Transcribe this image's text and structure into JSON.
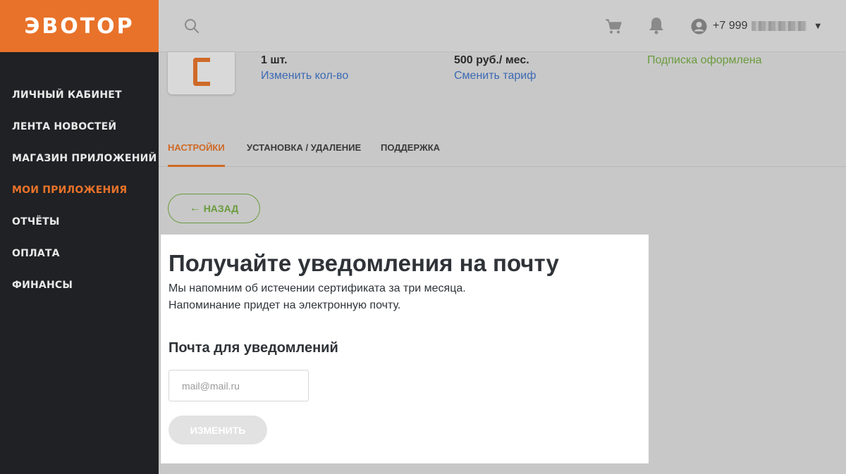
{
  "brand": {
    "logo_text": "ЭВОТОР",
    "accent": "#e8722a"
  },
  "sidebar": {
    "items": [
      {
        "label": "ЛИЧНЫЙ КАБИНЕТ",
        "active": false
      },
      {
        "label": "ЛЕНТА НОВОСТЕЙ",
        "active": false
      },
      {
        "label": "МАГАЗИН ПРИЛОЖЕНИЙ",
        "active": false
      },
      {
        "label": "МОИ ПРИЛОЖЕНИЯ",
        "active": true
      },
      {
        "label": "ОТЧЁТЫ",
        "active": false
      },
      {
        "label": "ОПЛАТА",
        "active": false
      },
      {
        "label": "ФИНАНСЫ",
        "active": false
      }
    ]
  },
  "topbar": {
    "icons": [
      "search-icon",
      "cart-icon",
      "bell-icon",
      "user-icon"
    ],
    "phone": "+7 999"
  },
  "app_summary": {
    "quantity": "1 шт.",
    "change_quantity": "Изменить кол-во",
    "price": "500 руб./ мес.",
    "change_plan": "Сменить тариф",
    "status": "Подписка оформлена"
  },
  "tabs": [
    {
      "label": "НАСТРОЙКИ",
      "active": true
    },
    {
      "label": "УСТАНОВКА / УДАЛЕНИЕ",
      "active": false
    },
    {
      "label": "ПОДДЕРЖКА",
      "active": false
    }
  ],
  "back_button": {
    "label": "НАЗАД"
  },
  "panel": {
    "title": "Получайте уведомления на почту",
    "text_line1": "Мы напомним об истечении сертификата за три месяца.",
    "text_line2": "Напоминание придет на электронную почту.",
    "subtitle": "Почта для уведомлений",
    "email_placeholder": "mail@mail.ru",
    "email_value": "",
    "submit_label": "ИЗМЕНИТЬ"
  },
  "colors": {
    "sidebar_bg": "#1f2124",
    "link": "#3b69b3",
    "success": "#6a9b3d",
    "overlay": "#c8c8c8"
  }
}
